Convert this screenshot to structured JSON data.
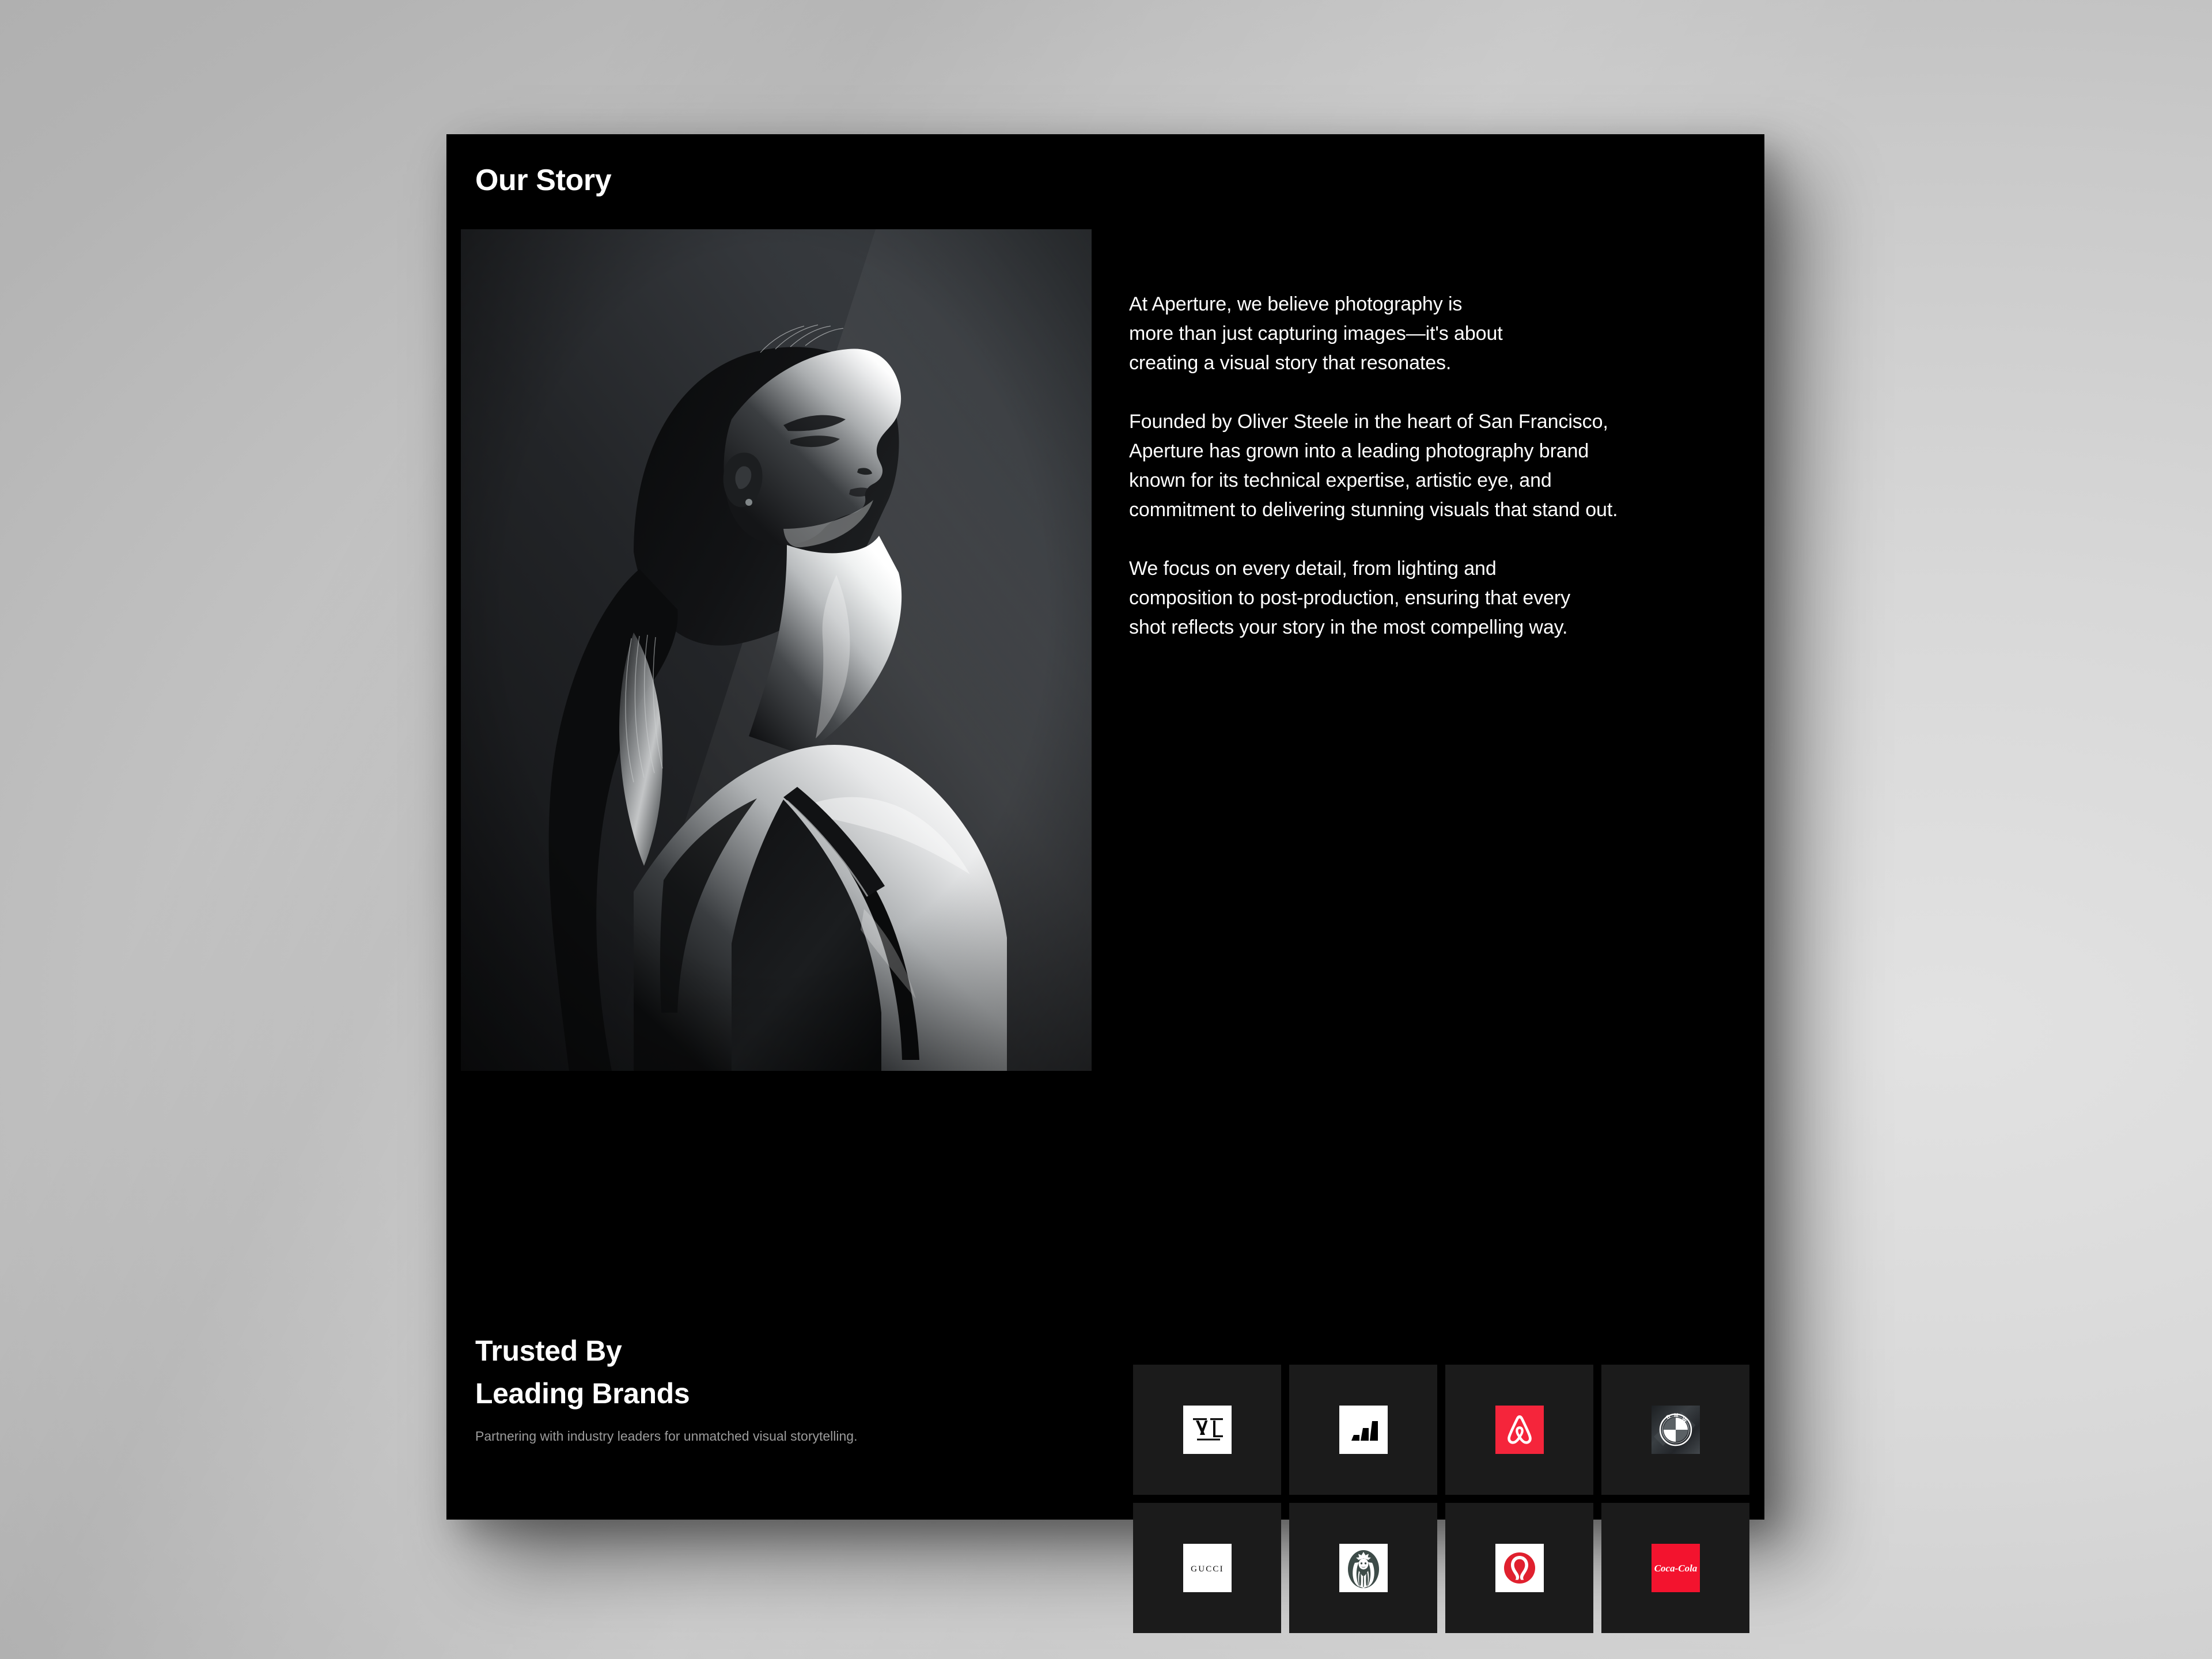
{
  "page": {
    "title": "Our Story",
    "background_top_left": "#ababab",
    "background_bottom_right": "#d6d6d6",
    "card_background": "#000000"
  },
  "story": {
    "paragraphs": [
      "At Aperture, we believe photography is\nmore than just capturing images—it's about\ncreating a visual story that resonates.",
      "Founded by Oliver Steele in the heart of San Francisco,\nAperture has grown into a leading photography brand\nknown for its technical expertise, artistic eye, and\ncommitment to delivering stunning visuals that stand out.",
      "We focus on every detail, from lighting and\ncomposition to post-production, ensuring that every\nshot reflects your story in the most compelling way."
    ]
  },
  "hero_image": {
    "alt": "Black and white portrait of a woman in profile with head tilted back, ponytail, dramatic rim lighting",
    "treatment": "monochrome"
  },
  "trusted_by": {
    "heading_line1": "Trusted By",
    "heading_line2": "Leading Brands",
    "subtitle": "Partnering with industry leaders for unmatched visual storytelling.",
    "tile_background": "#1b1b1b",
    "brands": [
      {
        "name": "Louis Vuitton",
        "icon": "louis-vuitton-logo",
        "patch": "patch-white",
        "accent": "#ffffff"
      },
      {
        "name": "Adidas",
        "icon": "adidas-logo",
        "patch": "patch-white",
        "accent": "#ffffff"
      },
      {
        "name": "Airbnb",
        "icon": "airbnb-logo",
        "patch": "patch-airbnb",
        "accent": "#f5253b"
      },
      {
        "name": "BMW",
        "icon": "bmw-logo",
        "patch": "patch-bmw",
        "accent": "#26292c"
      },
      {
        "name": "Gucci",
        "icon": "gucci-logo",
        "patch": "patch-white",
        "accent": "#ffffff"
      },
      {
        "name": "Starbucks",
        "icon": "starbucks-logo",
        "patch": "patch-sbux",
        "accent": "#3d4b48"
      },
      {
        "name": "Lululemon",
        "icon": "lululemon-logo",
        "patch": "patch-white",
        "accent": "#e0202e"
      },
      {
        "name": "Coca-Cola",
        "icon": "coca-cola-logo",
        "patch": "patch-coke",
        "accent": "#f3132e"
      }
    ]
  }
}
